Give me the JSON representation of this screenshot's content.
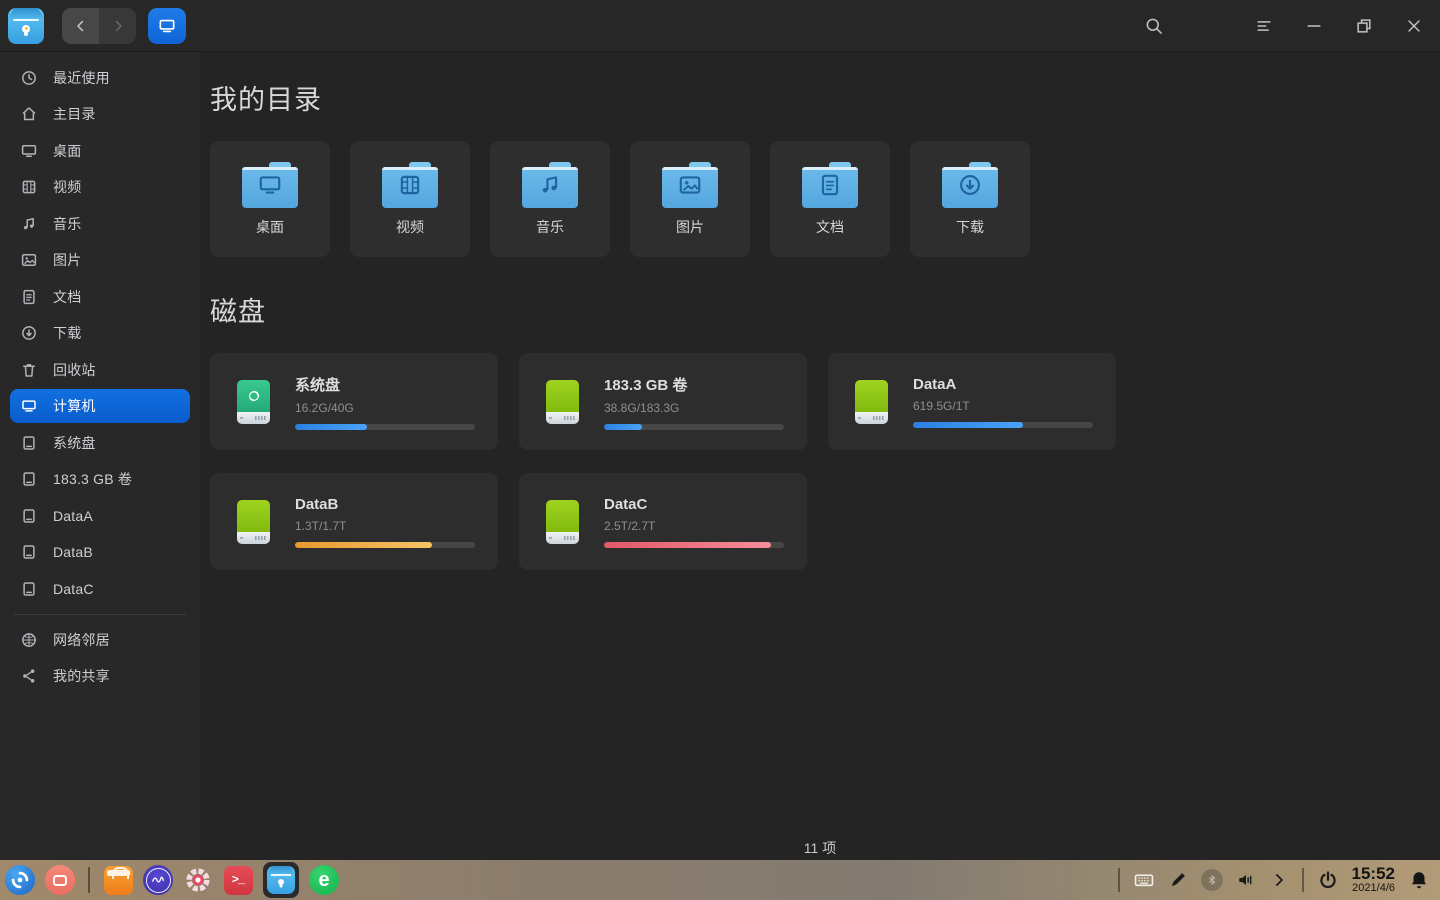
{
  "titlebar": {
    "app": "file-manager",
    "buttons": {
      "back": "back",
      "forward": "forward",
      "computer_view": "computer-view",
      "search": "search",
      "menu": "menu",
      "minimize": "minimize",
      "maximize": "maximize",
      "close": "close"
    }
  },
  "sidebar": {
    "items": [
      {
        "id": "recent",
        "icon": "clock",
        "label": "最近使用"
      },
      {
        "id": "home",
        "icon": "home",
        "label": "主目录"
      },
      {
        "id": "desktop",
        "icon": "desktop",
        "label": "桌面"
      },
      {
        "id": "videos",
        "icon": "film",
        "label": "视频"
      },
      {
        "id": "music",
        "icon": "music",
        "label": "音乐"
      },
      {
        "id": "pictures",
        "icon": "image",
        "label": "图片"
      },
      {
        "id": "documents",
        "icon": "document",
        "label": "文档"
      },
      {
        "id": "downloads",
        "icon": "download",
        "label": "下载"
      },
      {
        "id": "trash",
        "icon": "trash",
        "label": "回收站"
      },
      {
        "id": "computer",
        "icon": "computer",
        "label": "计算机",
        "selected": true
      },
      {
        "id": "system-disk",
        "icon": "disk",
        "label": "系统盘"
      },
      {
        "id": "volume-183gb",
        "icon": "disk",
        "label": "183.3 GB 卷"
      },
      {
        "id": "dataa",
        "icon": "disk",
        "label": "DataA"
      },
      {
        "id": "datab",
        "icon": "disk",
        "label": "DataB"
      },
      {
        "id": "datac",
        "icon": "disk",
        "label": "DataC"
      },
      {
        "divider": true
      },
      {
        "id": "network",
        "icon": "globe",
        "label": "网络邻居"
      },
      {
        "id": "shares",
        "icon": "share",
        "label": "我的共享"
      }
    ]
  },
  "content": {
    "section_my_directories": "我的目录",
    "section_disks": "磁盘",
    "folders": [
      {
        "id": "desktop",
        "glyph": "desktop",
        "label": "桌面"
      },
      {
        "id": "videos",
        "glyph": "film",
        "label": "视频"
      },
      {
        "id": "music",
        "glyph": "music",
        "label": "音乐"
      },
      {
        "id": "pictures",
        "glyph": "image",
        "label": "图片"
      },
      {
        "id": "documents",
        "glyph": "document",
        "label": "文档"
      },
      {
        "id": "downloads",
        "glyph": "download",
        "label": "下载"
      }
    ],
    "disks": [
      {
        "id": "system-disk",
        "name": "系统盘",
        "usage": "16.2G/40G",
        "percent": 40,
        "bar_color": "blue",
        "bar_hex": "#3b97f7",
        "icon": "system"
      },
      {
        "id": "volume-183gb",
        "name": "183.3 GB 卷",
        "usage": "38.8G/183.3G",
        "percent": 21,
        "bar_color": "blue",
        "bar_hex": "#3b97f7",
        "icon": "data"
      },
      {
        "id": "dataa",
        "name": "DataA",
        "usage": "619.5G/1T",
        "percent": 61,
        "bar_color": "blue",
        "bar_hex": "#3b97f7",
        "icon": "data"
      },
      {
        "id": "datab",
        "name": "DataB",
        "usage": "1.3T/1.7T",
        "percent": 76,
        "bar_color": "orange",
        "bar_hex": "#f2a93b",
        "icon": "data"
      },
      {
        "id": "datac",
        "name": "DataC",
        "usage": "2.5T/2.7T",
        "percent": 93,
        "bar_color": "red",
        "bar_hex": "#f06d7e",
        "icon": "data"
      }
    ],
    "status_text": "11 项"
  },
  "dock": {
    "items": [
      {
        "icon": "launcher"
      },
      {
        "icon": "multitask"
      },
      {
        "icon": "divider"
      },
      {
        "icon": "appstore"
      },
      {
        "icon": "sysmon"
      },
      {
        "icon": "controlcenter"
      },
      {
        "icon": "terminal",
        "glyph_text": ">_"
      },
      {
        "icon": "filemanager",
        "active": true
      },
      {
        "icon": "browser",
        "glyph_text": "e"
      }
    ]
  },
  "tray": {
    "items": [
      {
        "icon": "divider"
      },
      {
        "icon": "keyboard"
      },
      {
        "icon": "pen"
      },
      {
        "icon": "bluetooth"
      },
      {
        "icon": "volume"
      },
      {
        "icon": "chevron-right"
      },
      {
        "icon": "divider"
      },
      {
        "icon": "power"
      }
    ],
    "time": "15:52",
    "date": "2021/4/6"
  },
  "colors": {
    "accent_selected": "#0c63d5",
    "titlebar_bg": "#272727",
    "sidebar_bg": "#282828",
    "content_bg": "#242424",
    "card_bg": "#2d2d2d",
    "progress_blue": "#3b97f7",
    "progress_orange": "#f2a93b",
    "progress_red": "#f06d7e",
    "folder_blue": "#5fb0e6",
    "disk_green_system": "#2fc087",
    "disk_green_data": "#92c917",
    "taskbar_tint": "#94826e"
  }
}
